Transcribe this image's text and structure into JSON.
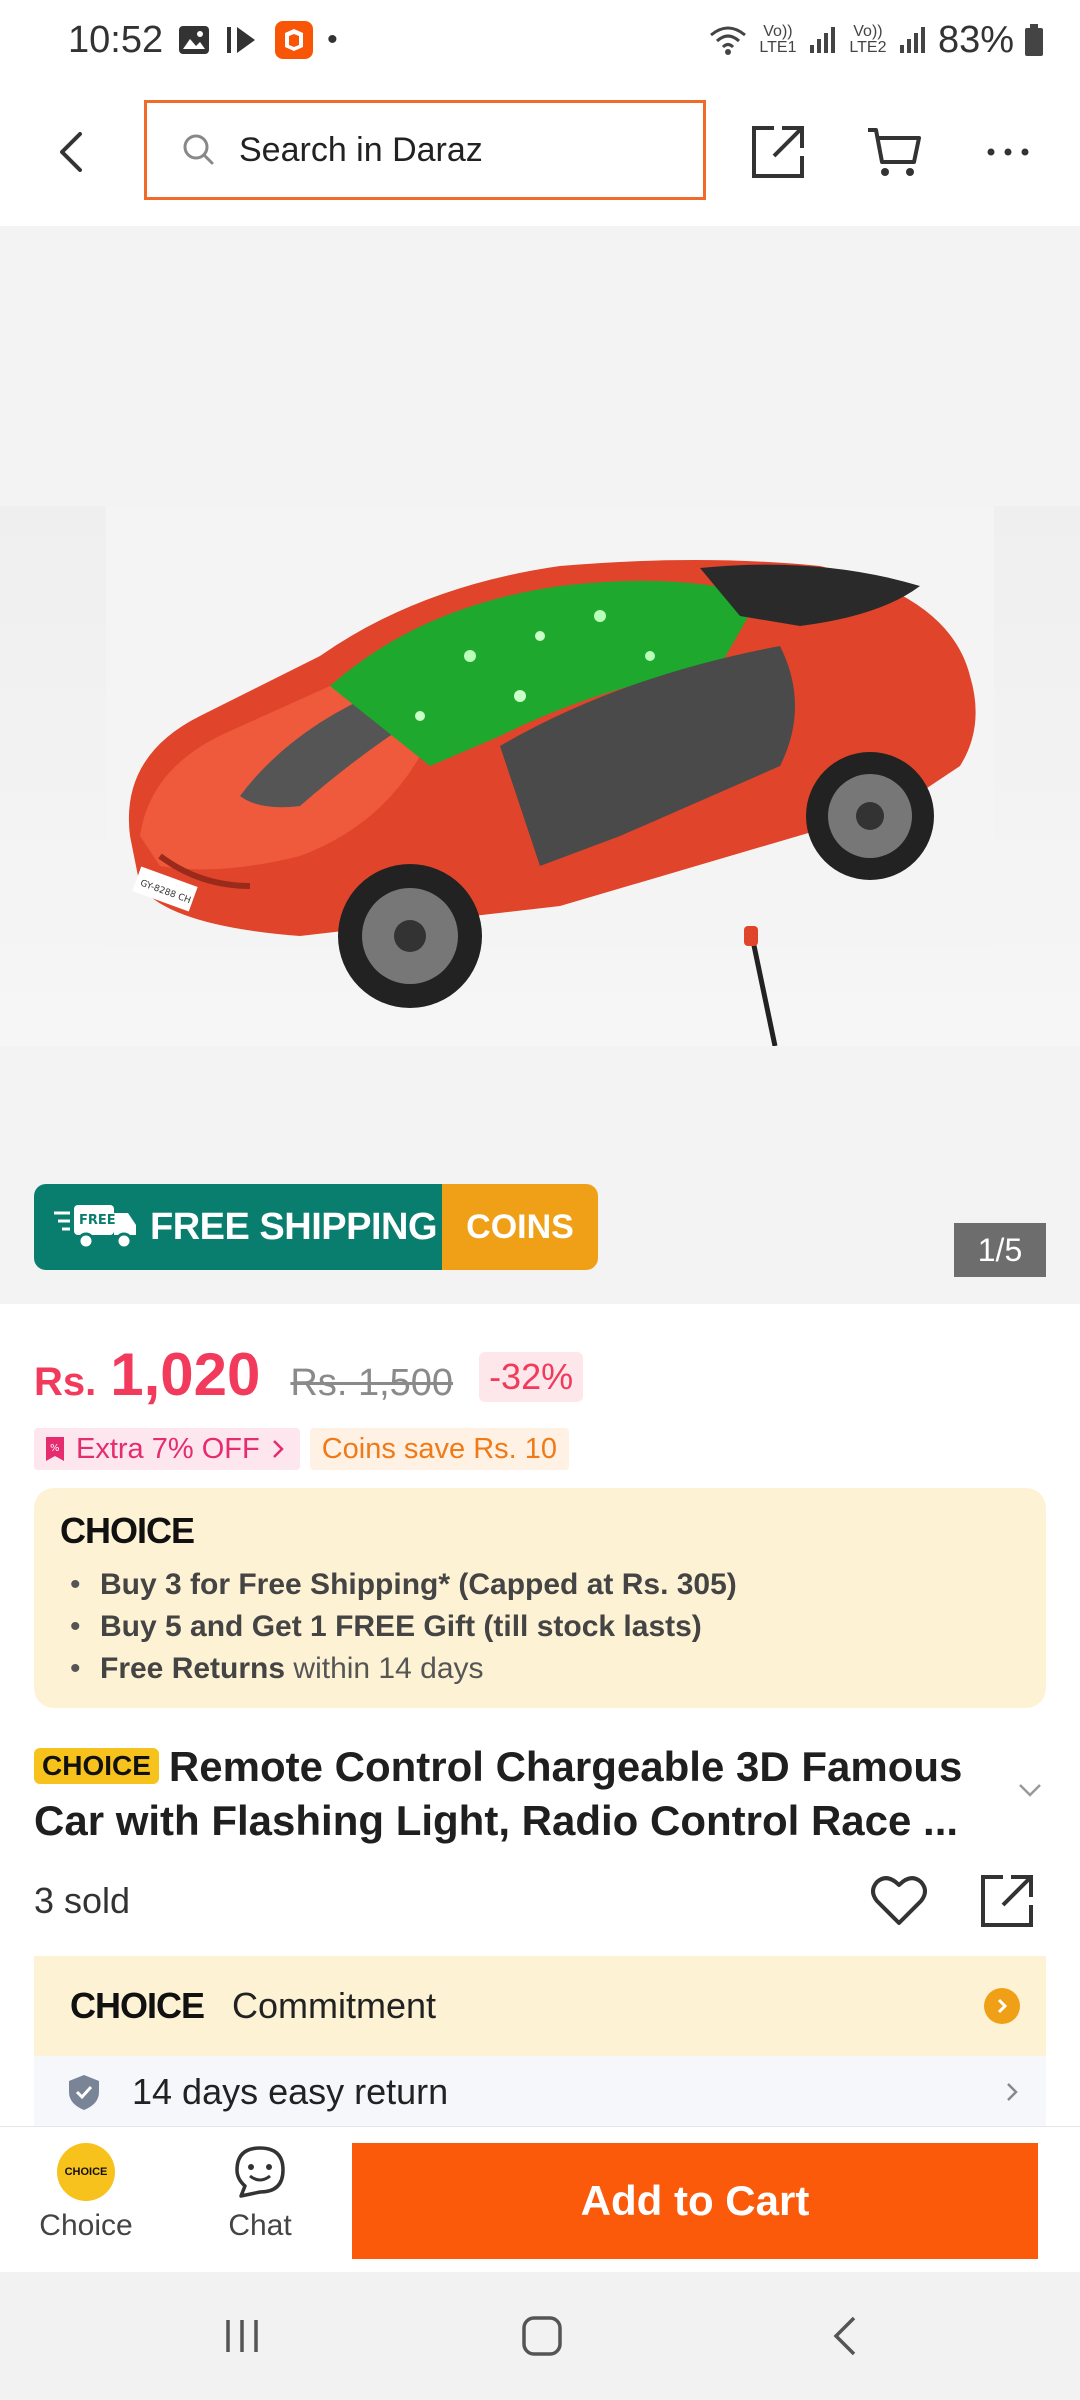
{
  "status_bar": {
    "time": "10:52",
    "dot": "•",
    "network1": "Vo)) LTE1",
    "network2": "Vo)) LTE2",
    "battery": "83%"
  },
  "top_nav": {
    "search_placeholder": "Search in Daraz"
  },
  "gallery": {
    "free_shipping_label": "FREE SHIPPING",
    "free_tag": "FREE",
    "coins_label": "COINS",
    "image_counter": "1/5",
    "plate_text": "GY-8288 CH"
  },
  "price": {
    "currency": "Rs.",
    "current": "1,020",
    "original": "Rs. 1,500",
    "discount": "-32%"
  },
  "promos": {
    "extra_off": "Extra 7% OFF",
    "coins_save": "Coins save Rs. 10"
  },
  "choice_card": {
    "logo": "CHOICE",
    "items": [
      {
        "bold": "Buy 3 for  Free Shipping* (Capped at Rs. 305)",
        "rest": ""
      },
      {
        "bold": "Buy 5 and Get 1 FREE Gift (till stock lasts)",
        "rest": ""
      },
      {
        "bold": "Free Returns",
        "rest": " within 14 days"
      }
    ]
  },
  "product": {
    "badge": "CHOICE",
    "title": "Remote Control Chargeable 3D Famous Car with Flashing Light, Radio Control Race ...",
    "sold": "3 sold"
  },
  "commitment": {
    "logo": "CHOICE",
    "label": "Commitment"
  },
  "returns": {
    "label": "14 days easy return"
  },
  "action_bar": {
    "choice_icon_text": "CHOICE",
    "choice_label": "Choice",
    "chat_label": "Chat",
    "add_to_cart": "Add to Cart"
  },
  "colors": {
    "accent": "#fa5a0a",
    "price": "#f23b5c",
    "free_shipping_green": "#0a7e6e",
    "coins_gold": "#f0a017",
    "choice_bg": "#fdf2d3"
  }
}
